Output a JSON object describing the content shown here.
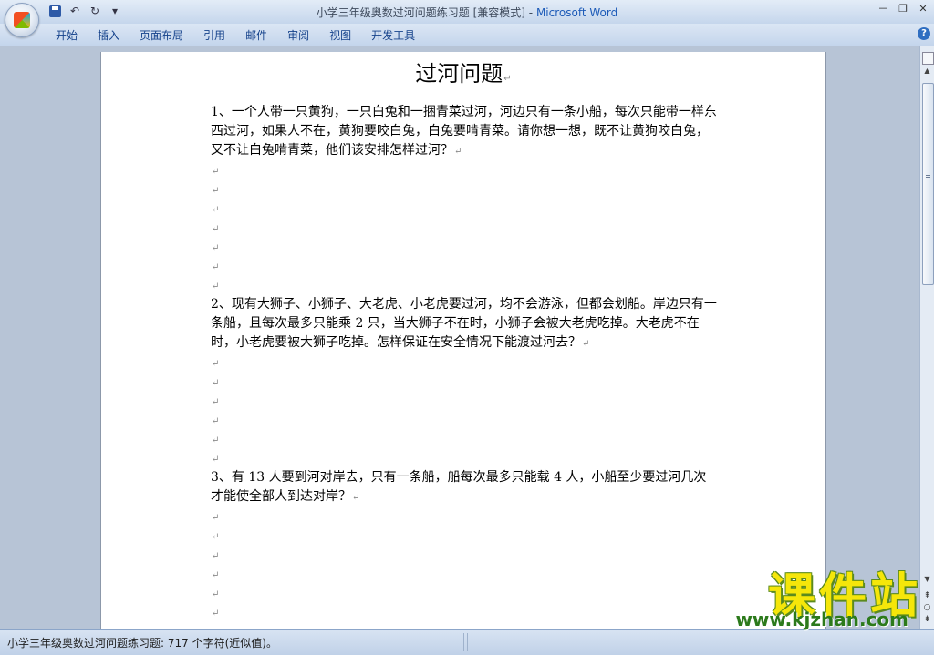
{
  "window": {
    "title_doc": "小学三年级奥数过河问题练习题 [兼容模式]",
    "title_sep": " - ",
    "title_app": "Microsoft Word",
    "minimize": "－",
    "restore": "❐",
    "close": "✕"
  },
  "qat": {
    "undo": "↶",
    "redo": "↻",
    "customize": "▾"
  },
  "ribbon": {
    "tabs": [
      "开始",
      "插入",
      "页面布局",
      "引用",
      "邮件",
      "审阅",
      "视图",
      "开发工具"
    ],
    "help": "?"
  },
  "document": {
    "title": "过河问题",
    "paragraph_mark": "↵",
    "questions": [
      "1、一个人带一只黄狗，一只白兔和一捆青菜过河，河边只有一条小船，每次只能带一样东西过河，如果人不在，黄狗要咬白兔，白兔要啃青菜。请你想一想，既不让黄狗咬白兔，又不让白兔啃青菜，他们该安排怎样过河？",
      "2、现有大狮子、小狮子、大老虎、小老虎要过河，均不会游泳，但都会划船。岸边只有一条船，且每次最多只能乘 2 只，当大狮子不在时，小狮子会被大老虎吃掉。大老虎不在时，小老虎要被大狮子吃掉。怎样保证在安全情况下能渡过河去？",
      "3、有 13 人要到河对岸去，只有一条船，船每次最多只能载 4 人，小船至少要过河几次才能使全部人到达对岸？"
    ]
  },
  "status": {
    "text": "小学三年级奥数过河问题练习题: 717 个字符(近似值)。"
  },
  "watermark": {
    "big": "课件站",
    "url": "www.kjzhan.com"
  }
}
